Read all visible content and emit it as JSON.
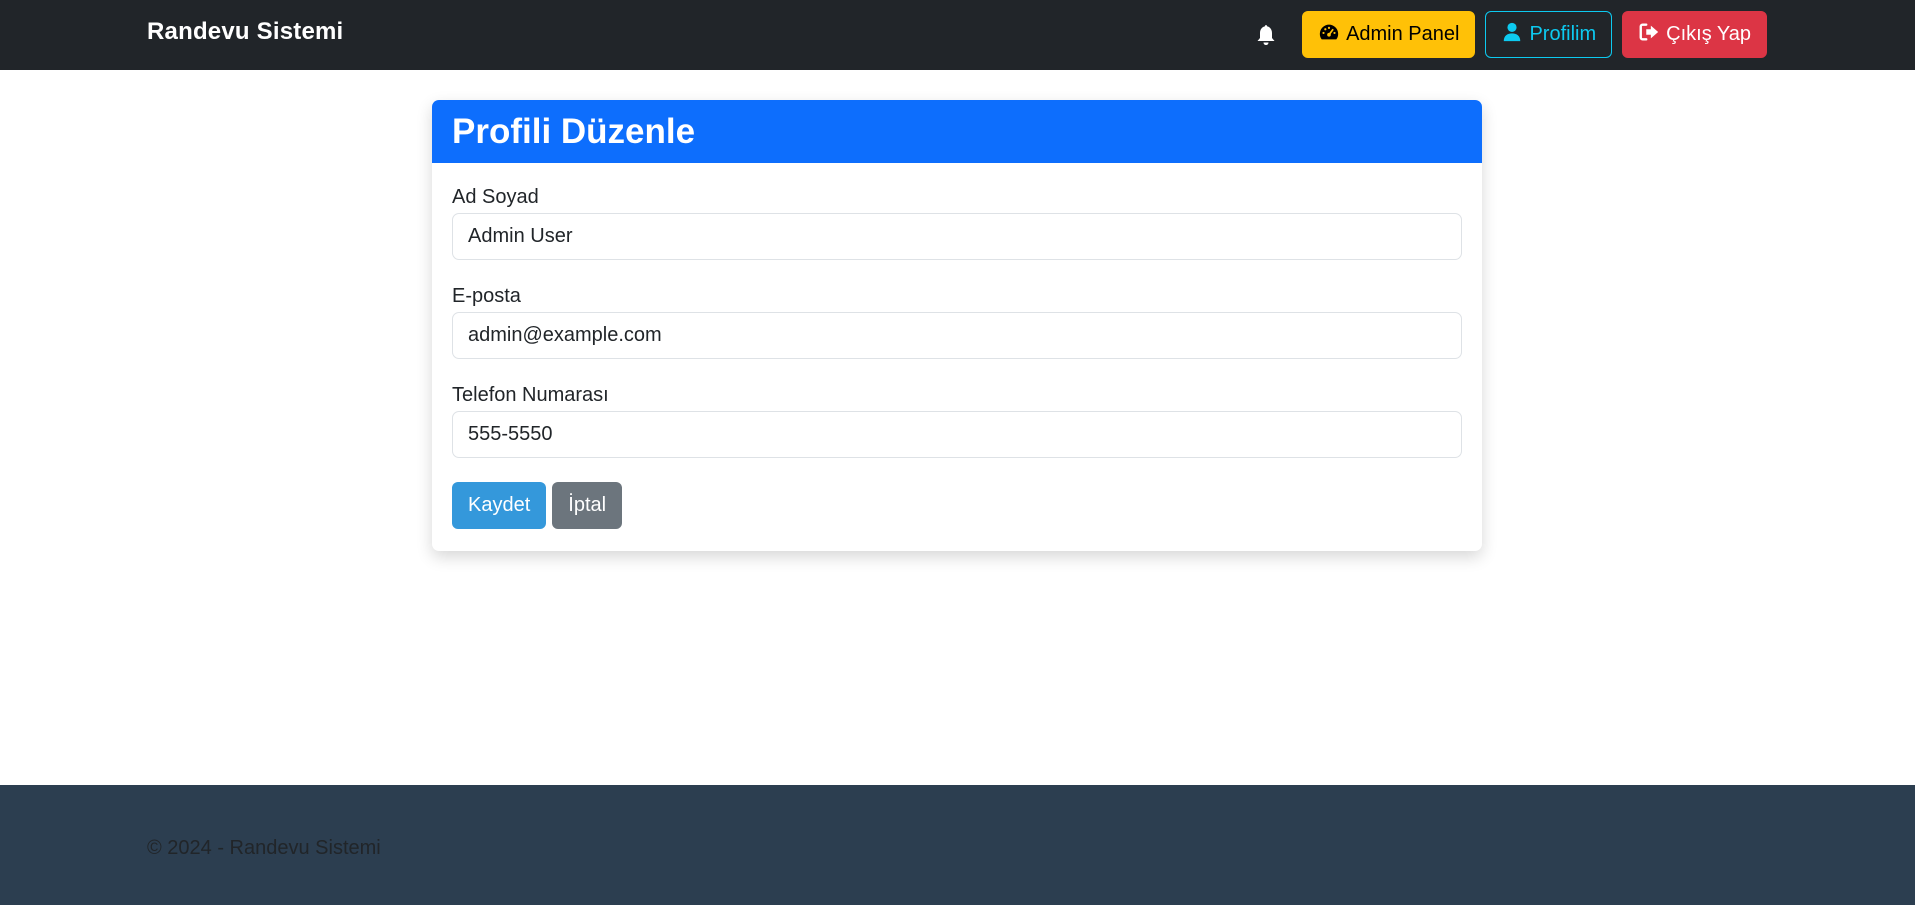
{
  "navbar": {
    "brand": "Randevu Sistemi",
    "notifications_icon": "bell-icon",
    "admin_panel": {
      "label": "Admin Panel",
      "icon": "gauge-icon"
    },
    "profile": {
      "label": "Profilim",
      "icon": "user-icon"
    },
    "logout": {
      "label": "Çıkış Yap",
      "icon": "sign-out-icon"
    }
  },
  "form": {
    "title": "Profili Düzenle",
    "fields": [
      {
        "label": "Ad Soyad",
        "value": "Admin User"
      },
      {
        "label": "E-posta",
        "value": "admin@example.com"
      },
      {
        "label": "Telefon Numarası",
        "value": "555-5550"
      }
    ],
    "save_label": "Kaydet",
    "cancel_label": "İptal"
  },
  "footer": {
    "text": "© 2024 - Randevu Sistemi"
  },
  "colors": {
    "navbar_bg": "#212529",
    "primary": "#0d6efd",
    "warning": "#ffc107",
    "info": "#0dcaf0",
    "danger": "#dc3545",
    "save": "#3498db",
    "secondary": "#6c757d",
    "footer_bg": "#2c3e50"
  }
}
